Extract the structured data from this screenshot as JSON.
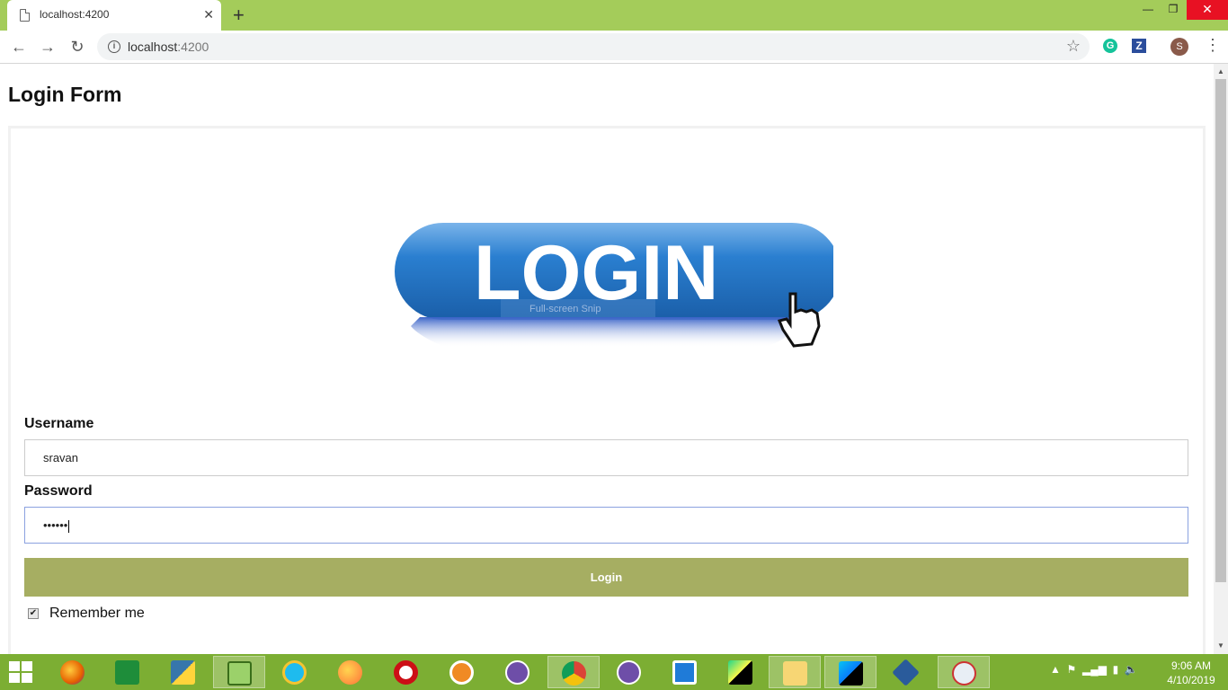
{
  "browser": {
    "tab_title": "localhost:4200",
    "tab_close": "✕",
    "new_tab": "+",
    "url_host": "localhost",
    "url_port": ":4200",
    "window_controls": {
      "minimize": "—",
      "restore": "❐",
      "close": "✕"
    },
    "nav": {
      "back": "←",
      "forward": "→",
      "reload": "↻"
    },
    "profile_initial": "S"
  },
  "page": {
    "title": "Login Form",
    "logo_text": "LOGIN",
    "logo_overlay": "Full-screen Snip",
    "username_label": "Username",
    "username_value": "sravan",
    "password_label": "Password",
    "password_value": "••••••",
    "login_button": "Login",
    "remember_label": "Remember me",
    "remember_checked": true
  },
  "taskbar": {
    "time": "9:06 AM",
    "date": "4/10/2019",
    "apps": [
      "firefox",
      "store",
      "python",
      "notepad",
      "ie",
      "firefox-dev",
      "opera",
      "vlc",
      "github",
      "chrome",
      "github",
      "brackets",
      "pycharm",
      "file-explorer",
      "webstorm",
      "virtualbox",
      "snipping-tool"
    ]
  },
  "colors": {
    "browser_chrome": "#a4cc5a",
    "taskbar": "#7cae33",
    "login_button": "#a6ae62",
    "logo_blue": "#1f6fc0"
  }
}
